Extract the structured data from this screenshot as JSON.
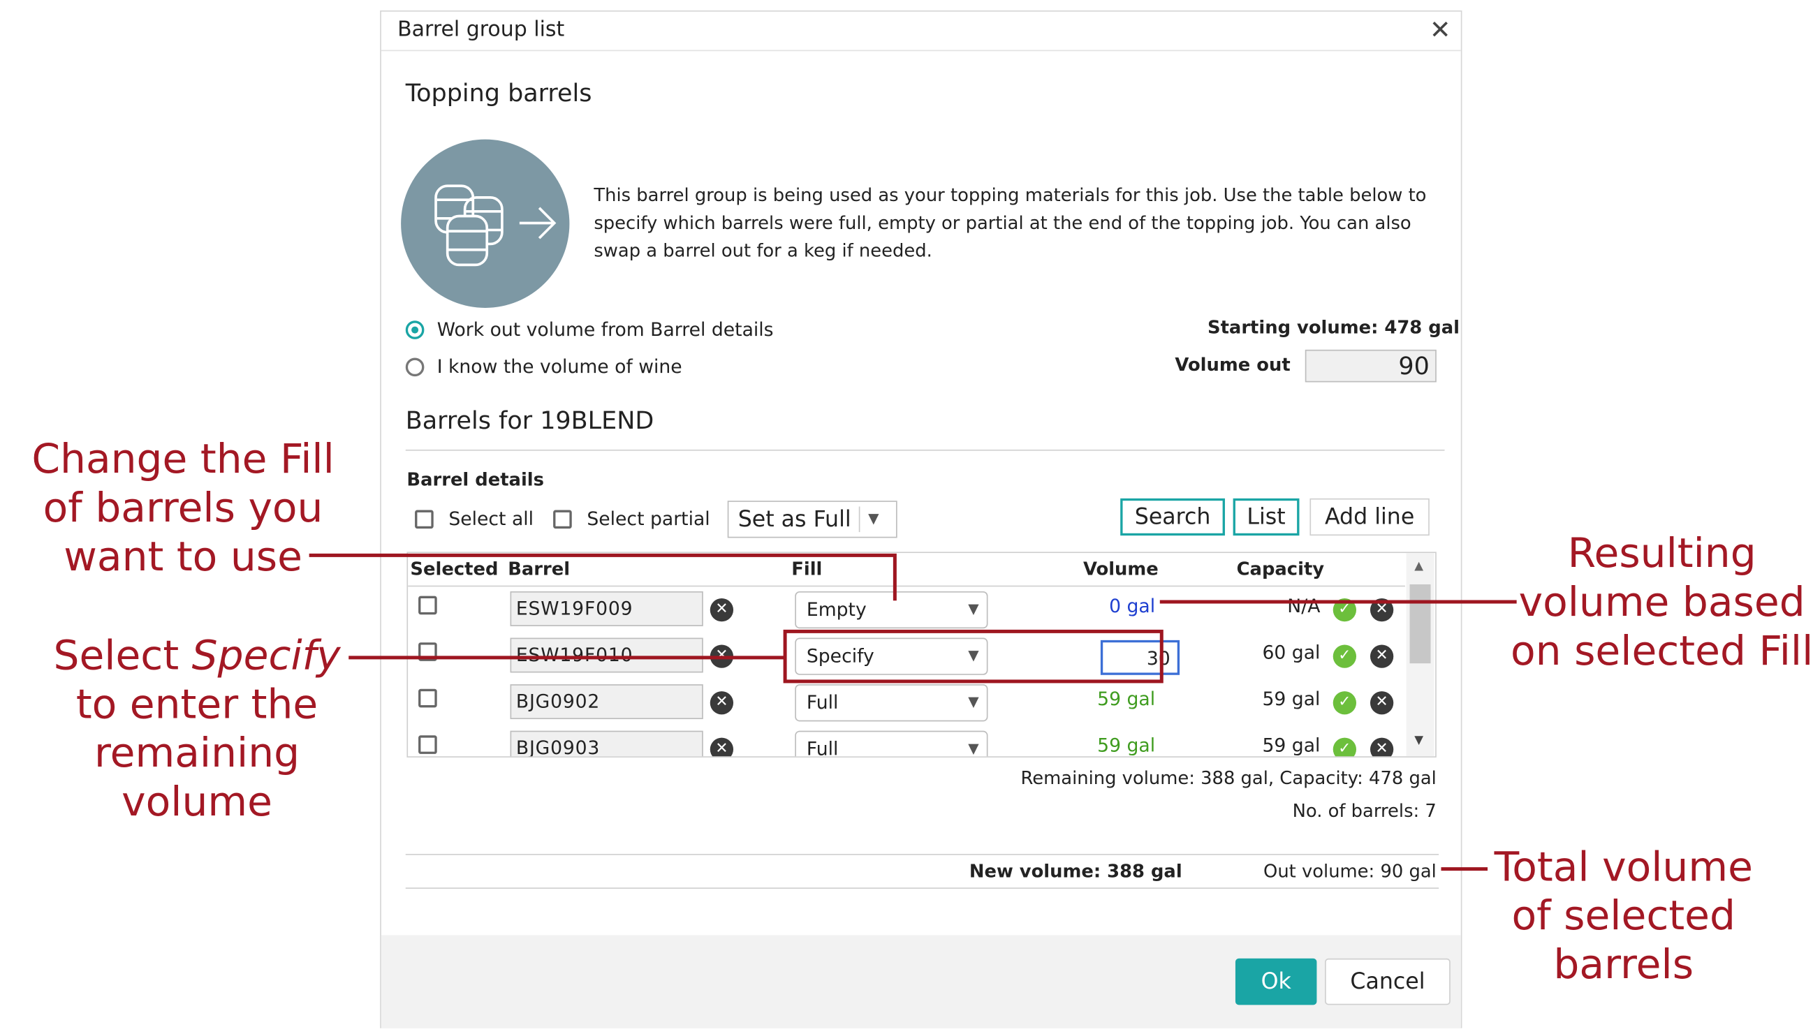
{
  "dialog": {
    "title": "Barrel group list",
    "section_title": "Topping barrels",
    "description": "This barrel group is being used as your topping materials for this job. Use the table below to specify which barrels were full, empty or partial at the end of the topping job. You can also swap a barrel out for a keg if needed.",
    "radio_work_out": "Work out volume from Barrel details",
    "radio_know": "I know the volume of wine",
    "starting_volume": "Starting volume: 478 gal",
    "volume_out_label": "Volume out",
    "volume_out_value": "90",
    "barrels_title": "Barrels for 19BLEND",
    "barrel_details_label": "Barrel details",
    "select_all": "Select all",
    "select_partial": "Select partial",
    "set_as_full": "Set as Full",
    "search_btn": "Search",
    "list_btn": "List",
    "add_line_btn": "Add line",
    "remaining": "Remaining volume: 388 gal, Capacity: 478 gal",
    "num_barrels": "No. of barrels: 7",
    "new_volume": "New volume: 388 gal",
    "out_volume": "Out volume: 90 gal",
    "ok_btn": "Ok",
    "cancel_btn": "Cancel"
  },
  "table": {
    "headers": [
      "Selected",
      "Barrel",
      "Fill",
      "Volume",
      "Capacity"
    ],
    "rows": [
      {
        "barrel": "ESW19F009",
        "fill": "Empty",
        "volume": "0 gal",
        "capacity": "N/A"
      },
      {
        "barrel": "ESW19F010",
        "fill": "Specify",
        "volume": "30",
        "capacity": "60 gal"
      },
      {
        "barrel": "BJG0902",
        "fill": "Full",
        "volume": "59 gal",
        "capacity": "59 gal"
      },
      {
        "barrel": "BJG0903",
        "fill": "Full",
        "volume": "59 gal",
        "capacity": "59 gal"
      }
    ]
  },
  "annotations": {
    "fill_line1": "Change the Fill",
    "fill_line2": "of barrels you",
    "fill_line3": "want to use",
    "specify_pre": "Select ",
    "specify_word": "Specify",
    "specify_line2": "to enter the",
    "specify_line3": "remaining",
    "specify_line4": "volume",
    "result_line1": "Resulting",
    "result_line2": "volume based",
    "result_line3": "on selected Fill",
    "total_line1": "Total volume",
    "total_line2": "of selected",
    "total_line3": "barrels"
  },
  "colors": {
    "accent": "#1aa5a5",
    "annotation": "#a31824",
    "volume_blue": "#1e3fd0",
    "volume_green": "#3f9c1f"
  }
}
